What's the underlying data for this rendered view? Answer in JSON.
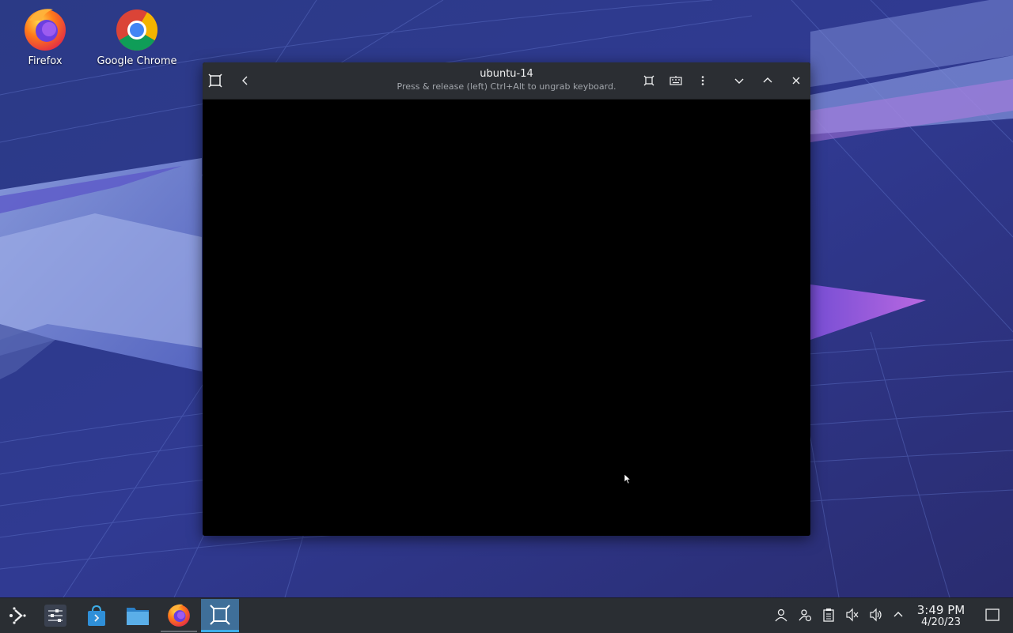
{
  "desktop": {
    "icons": [
      {
        "label": "Firefox",
        "icon": "firefox-icon"
      },
      {
        "label": "Google Chrome",
        "icon": "chrome-icon"
      }
    ]
  },
  "vm_window": {
    "title": "ubuntu-14",
    "subtitle": "Press & release (left) Ctrl+Alt to ungrab keyboard.",
    "header_buttons": [
      "app-icon",
      "back-icon",
      "fullscreen-icon",
      "keyboard-icon",
      "menu-kebab-icon",
      "minimize-icon",
      "maximize-icon",
      "close-icon"
    ]
  },
  "taskbar": {
    "items": [
      "application-launcher-icon",
      "system-settings-icon",
      "discover-store-icon",
      "file-manager-icon",
      "firefox-icon",
      "virtual-machine-manager-icon"
    ],
    "active_item": "virtual-machine-manager-icon",
    "tray": [
      "user-icon",
      "user-switch-icon",
      "clipboard-icon",
      "volume-muted-icon",
      "volume-icon",
      "tray-expand-icon"
    ],
    "clock": {
      "time": "3:49 PM",
      "date": "4/20/23"
    }
  },
  "colors": {
    "taskbar_bg": "#2a2e33",
    "header_bg": "#2b2e33",
    "accent": "#3daee9",
    "active_task_bg": "#3f6f99"
  }
}
